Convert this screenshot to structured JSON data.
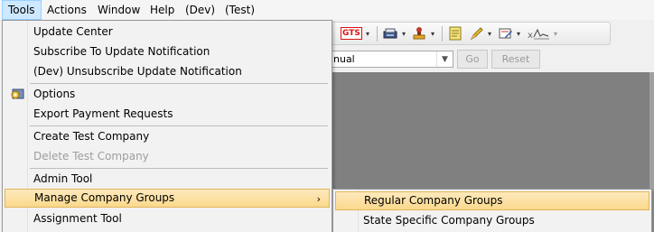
{
  "menubar": {
    "items": [
      {
        "label": "Tools"
      },
      {
        "label": "Actions"
      },
      {
        "label": "Window"
      },
      {
        "label": "Help"
      },
      {
        "label": "(Dev)"
      },
      {
        "label": "(Test)"
      }
    ]
  },
  "toolbar": {
    "gts_label": "GTS",
    "icons": [
      "gts-icon",
      "scanner-icon",
      "stamp-icon",
      "notepad-icon",
      "pencil-icon",
      "form-edit-icon",
      "signature-icon"
    ]
  },
  "filterbar": {
    "combo_value": "nual",
    "go_label": "Go",
    "reset_label": "Reset"
  },
  "tools_menu": {
    "items": [
      {
        "label": "Update Center"
      },
      {
        "label": "Subscribe To Update Notification"
      },
      {
        "label": "(Dev) Unsubscribe Update Notification"
      },
      {
        "label": "Options"
      },
      {
        "label": "Export Payment Requests"
      },
      {
        "label": "Create Test Company"
      },
      {
        "label": "Delete Test Company"
      },
      {
        "label": "Admin Tool"
      },
      {
        "label": "Manage Company Groups"
      },
      {
        "label": "Assignment Tool"
      }
    ],
    "submenu_arrow": "›"
  },
  "submenu": {
    "items": [
      {
        "label": "Regular Company Groups"
      },
      {
        "label": "State Specific Company Groups"
      }
    ]
  },
  "colors": {
    "highlight_top": "#fde9bd",
    "highlight_bottom": "#fbd98c",
    "highlight_border": "#e3b55c",
    "workspace": "#808080"
  }
}
